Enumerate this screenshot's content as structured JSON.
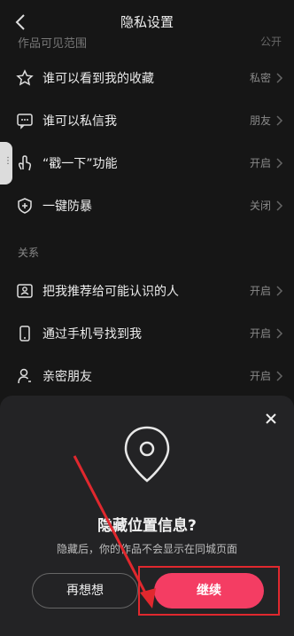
{
  "header": {
    "title": "隐私设置"
  },
  "partial_row": {
    "label": "作品可见范围",
    "value": "公开"
  },
  "rows": [
    {
      "label": "谁可以看到我的收藏",
      "value": "私密",
      "icon": "star-icon"
    },
    {
      "label": "谁可以私信我",
      "value": "朋友",
      "icon": "message-icon"
    },
    {
      "label": "“戳一下”功能",
      "value": "开启",
      "icon": "poke-hand-icon"
    },
    {
      "label": "一键防暴",
      "value": "关闭",
      "icon": "shield-icon"
    },
    {
      "label": "把我推荐给可能认识的人",
      "value": "开启",
      "icon": "id-card-icon"
    },
    {
      "label": "通过手机号找到我",
      "value": "开启",
      "icon": "phone-icon"
    },
    {
      "label": "亲密朋友",
      "value": "开启",
      "icon": "person-icon"
    }
  ],
  "section_label": "关系",
  "sheet": {
    "title": "隐藏位置信息?",
    "description": "隐藏后，你的作品不会显示在同城页面",
    "cancel_label": "再想想",
    "confirm_label": "继续"
  },
  "colors": {
    "accent": "#f43d63",
    "annotation": "#e0282e"
  }
}
